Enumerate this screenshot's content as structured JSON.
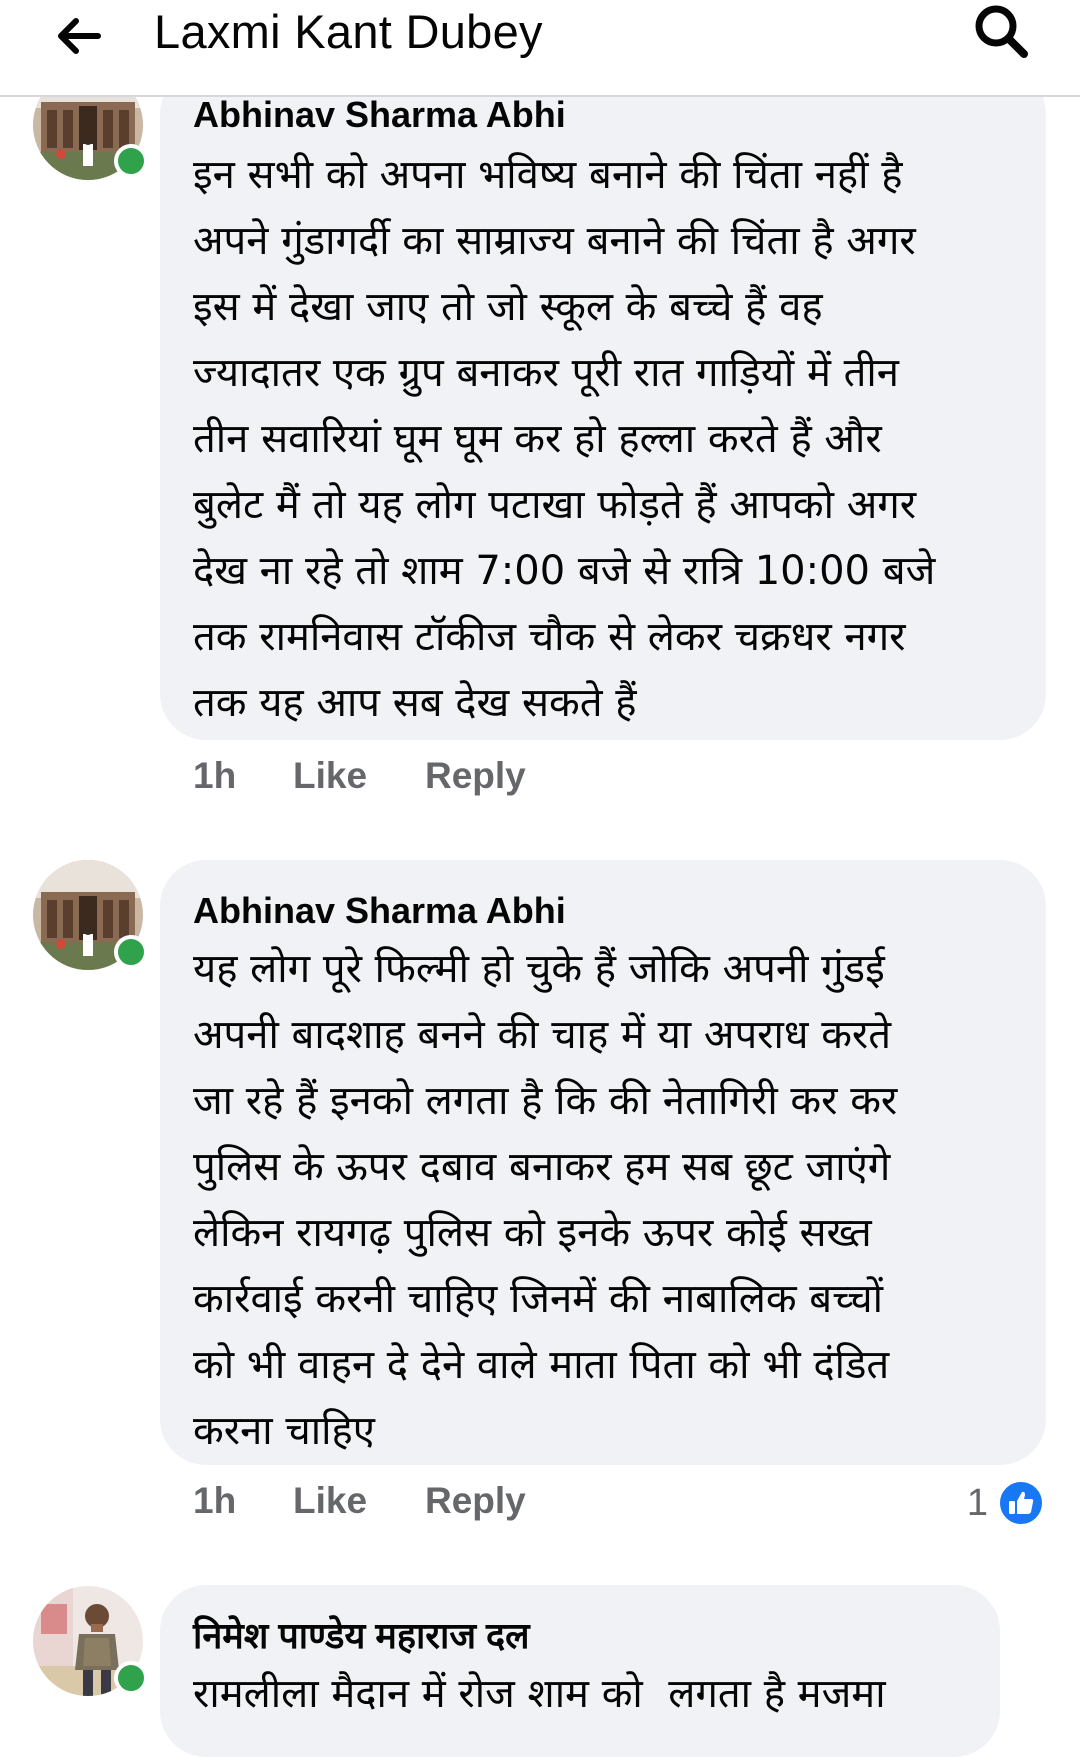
{
  "header": {
    "title": "Laxmi Kant Dubey",
    "back_icon": "arrow-left-icon",
    "search_icon": "search-icon"
  },
  "colors": {
    "bubble_bg": "#f0f2f5",
    "online_green": "#31a24c",
    "action_gray": "#65676b",
    "like_blue": "#1877f2"
  },
  "comments": [
    {
      "author": "Abhinav Sharma Abhi",
      "text": "इन सभी को अपना भविष्य बनाने की चिंता नहीं है\nअपने गुंडागर्दी का साम्राज्य बनाने की चिंता है अगर\nइस में देखा जाए तो जो स्कूल के बच्चे हैं वह\nज्यादातर एक ग्रुप बनाकर पूरी रात गाड़ियों में तीन\nतीन सवारियां घूम घूम कर हो हल्ला करते हैं और\nबुलेट मैं तो यह लोग पटाखा फोड़ते हैं आपको अगर\nदेख ना रहे तो शाम 7:00 बजे से रात्रि 10:00 बजे\nतक रामनिवास टॉकीज चौक से लेकर चक्रधर नगर\nतक यह आप सब देख सकते हैं",
      "time": "1h",
      "like_label": "Like",
      "reply_label": "Reply",
      "online": true
    },
    {
      "author": "Abhinav Sharma Abhi",
      "text": "यह लोग पूरे फिल्मी हो चुके हैं जोकि अपनी गुंडई\nअपनी बादशाह बनने की चाह में या अपराध करते\nजा रहे हैं इनको लगता है कि की नेतागिरी कर कर\nपुलिस के ऊपर दबाव बनाकर हम सब छूट जाएंगे\nलेकिन रायगढ़ पुलिस को इनके ऊपर कोई सख्त\nकार्रवाई करनी चाहिए जिनमें की नाबालिक बच्चों\nको भी वाहन दे देने वाले माता पिता को भी दंडित\nकरना चाहिए",
      "time": "1h",
      "like_label": "Like",
      "reply_label": "Reply",
      "reaction_count": "1",
      "reaction_icon": "thumbs-up-icon",
      "online": true
    },
    {
      "author": "निमेश पाण्डेय महाराज दल",
      "text": "रामलीला मैदान में रोज शाम को  लगता है मजमा",
      "online": true
    }
  ]
}
